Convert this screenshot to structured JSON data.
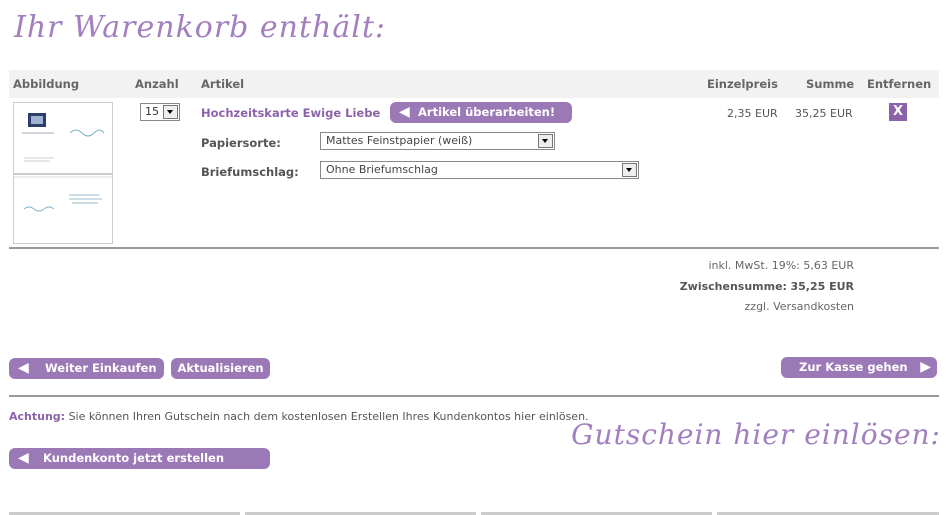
{
  "page": {
    "title": "Ihr Warenkorb enthält:"
  },
  "table": {
    "headers": {
      "image": "Abbildung",
      "qty": "Anzahl",
      "article": "Artikel",
      "unit_price": "Einzelpreis",
      "total": "Summe",
      "remove": "Entfernen"
    }
  },
  "item": {
    "quantity": "15",
    "name": "Hochzeitskarte Ewige Liebe",
    "edit_label": "Artikel überarbeiten!",
    "paper_label": "Papiersorte:",
    "paper_value": "Mattes Feinstpapier (weiß)",
    "envelope_label": "Briefumschlag:",
    "envelope_value": "Ohne Briefumschlag",
    "unit_price": "2,35 EUR",
    "total": "35,25 EUR",
    "remove_label": "X"
  },
  "summary": {
    "vat_label": "inkl. MwSt. 19%:",
    "vat_value": "5,63 EUR",
    "subtotal_label": "Zwischensumme:",
    "subtotal_value": "35,25 EUR",
    "shipping_prefix": "zzgl.",
    "shipping_link": "Versandkosten"
  },
  "buttons": {
    "continue": "Weiter Einkaufen",
    "update": "Aktualisieren",
    "checkout": "Zur Kasse gehen",
    "create_account": "Kundenkonto jetzt erstellen"
  },
  "notice": {
    "label": "Achtung:",
    "text": "Sie können Ihren Gutschein nach dem kostenlosen Erstellen Ihres Kundenkontos hier einlösen."
  },
  "voucher": {
    "title": "Gutschein hier einlösen:"
  },
  "colors": {
    "accent": "#9b79b7",
    "accent_dark": "#8c63aa"
  }
}
